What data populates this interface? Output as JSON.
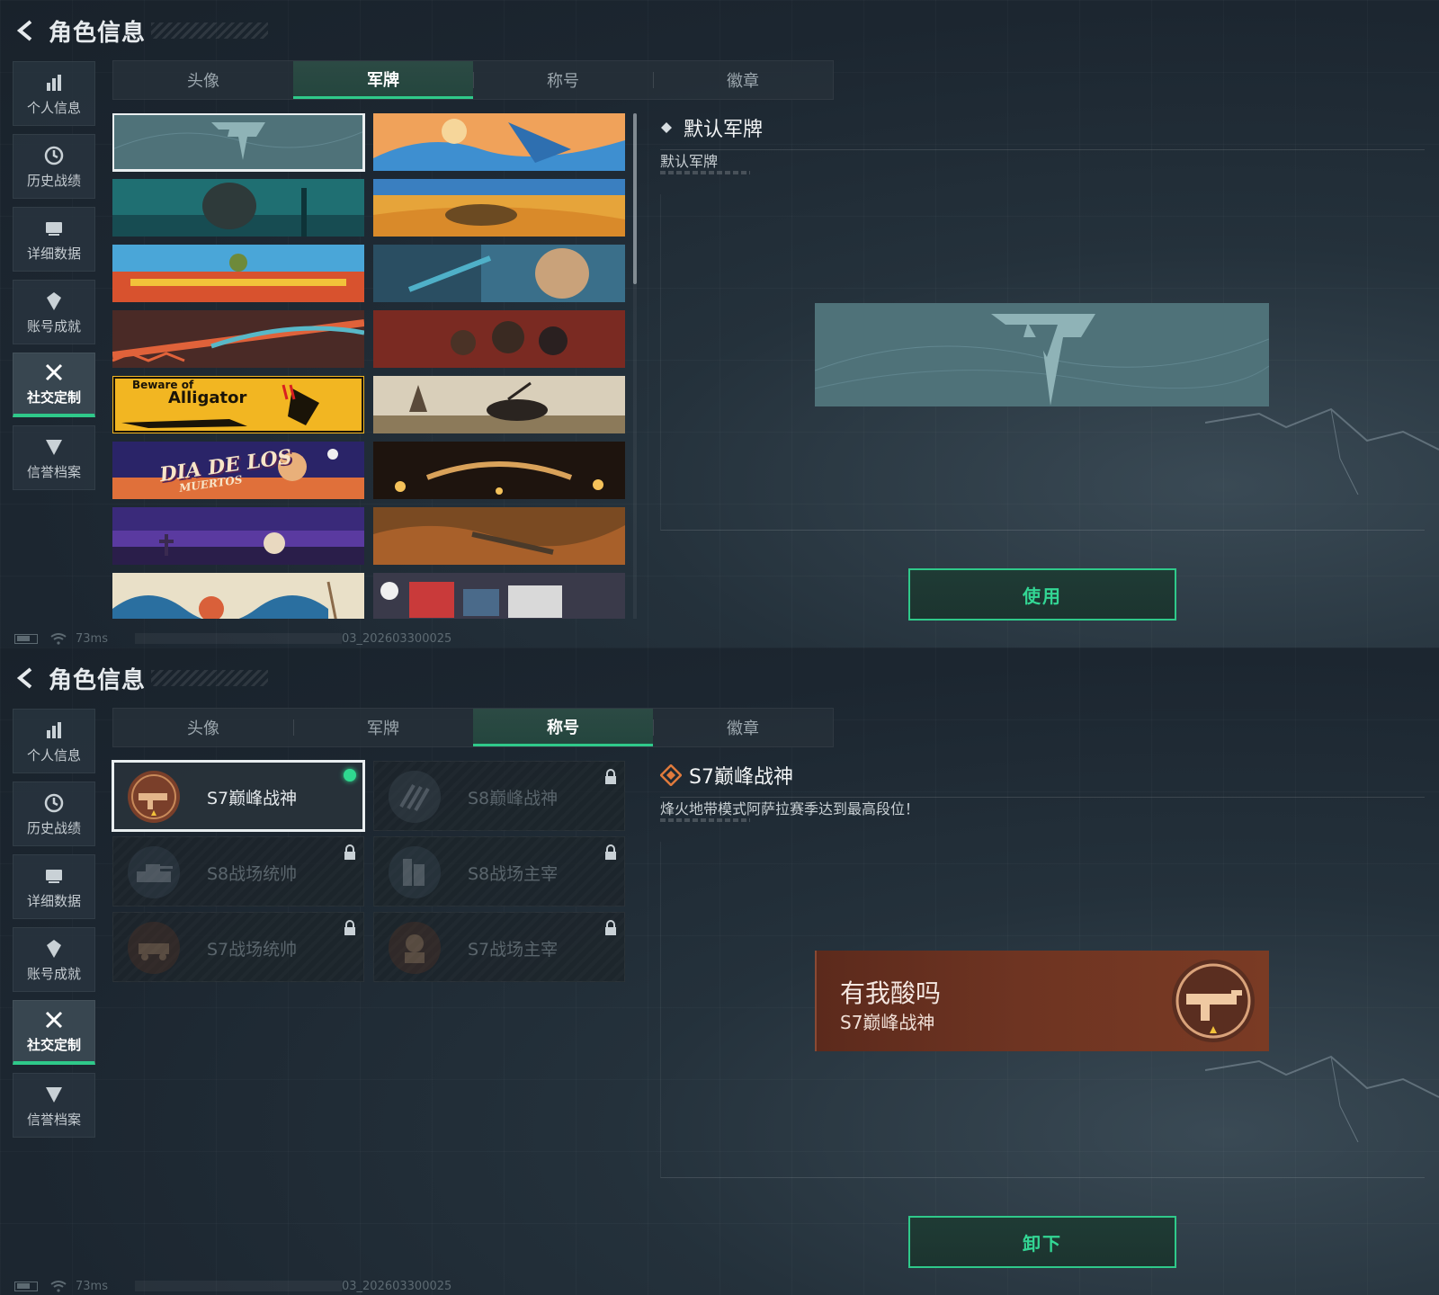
{
  "header": {
    "title": "角色信息"
  },
  "sidebar": {
    "items": [
      {
        "label": "个人信息",
        "icon": "bar-chart-icon"
      },
      {
        "label": "历史战绩",
        "icon": "history-icon"
      },
      {
        "label": "详细数据",
        "icon": "data-icon"
      },
      {
        "label": "账号成就",
        "icon": "achievement-icon"
      },
      {
        "label": "社交定制",
        "icon": "tools-icon",
        "active": true
      },
      {
        "label": "信誉档案",
        "icon": "credit-icon"
      }
    ]
  },
  "tabs": [
    "头像",
    "军牌",
    "称号",
    "徽章"
  ],
  "screen1": {
    "active_tab": "军牌",
    "cards": {
      "alligator_small": "Beware of",
      "alligator_big": "Alligator",
      "dia_text": "DIA DE LOS",
      "dia_sub": "MUERTOS"
    },
    "detail_title": "默认军牌",
    "detail_desc": "默认军牌",
    "action_label": "使用"
  },
  "screen2": {
    "active_tab": "称号",
    "titles": [
      {
        "name": "S7巅峰战神",
        "locked": false,
        "selected": true
      },
      {
        "name": "S8巅峰战神",
        "locked": true
      },
      {
        "name": "S8战场统帅",
        "locked": true
      },
      {
        "name": "S8战场主宰",
        "locked": true
      },
      {
        "name": "S7战场统帅",
        "locked": true
      },
      {
        "name": "S7战场主宰",
        "locked": true
      }
    ],
    "detail_title": "S7巅峰战神",
    "detail_desc": "烽火地带模式阿萨拉赛季达到最高段位！",
    "banner_quote": "有我酸吗",
    "banner_name": "S7巅峰战神",
    "action_label": "卸下"
  },
  "status": {
    "ping": "73ms",
    "build": "03_202603300025"
  },
  "colors": {
    "accent": "#2fc98a",
    "title_orange": "#e07a3c",
    "banner": "#6e3422"
  }
}
